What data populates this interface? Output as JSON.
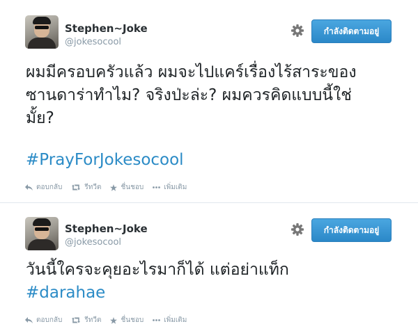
{
  "tweets": [
    {
      "name": "Stephen~Joke",
      "handle": "@jokesocool",
      "follow_label": "กำลังติดตามอยู่",
      "text_lines": [
        "ผมมีครอบครัวแล้ว ผมจะไปแคร์เรื่องไร้สาระของ",
        "ซานดาร่าทำไม? จริงป่ะล่ะ? ผมควรคิดแบบนี้ใช่",
        "มั้ย?"
      ],
      "hashtag": "#PrayForJokesocool",
      "actions": {
        "reply": "ตอบกลับ",
        "retweet": "รีทวีต",
        "favorite": "ชื่นชอบ",
        "more": "เพิ่มเติม"
      }
    },
    {
      "name": "Stephen~Joke",
      "handle": "@jokesocool",
      "follow_label": "กำลังติดตามอยู่",
      "text_lines": [
        "วันนี้ใครจะคุยอะไรมาก็ได้ แต่อย่าแท็ก"
      ],
      "hashtag": "#darahae",
      "actions": {
        "reply": "ตอบกลับ",
        "retweet": "รีทวีต",
        "favorite": "ชื่นชอบ",
        "more": "เพิ่มเติม"
      }
    }
  ],
  "colors": {
    "follow_button": "#2b88c8",
    "hashtag": "#2b8bc6",
    "muted": "#8899a6"
  },
  "icons": [
    "gear-icon",
    "reply-icon",
    "retweet-icon",
    "star-icon",
    "more-icon"
  ]
}
